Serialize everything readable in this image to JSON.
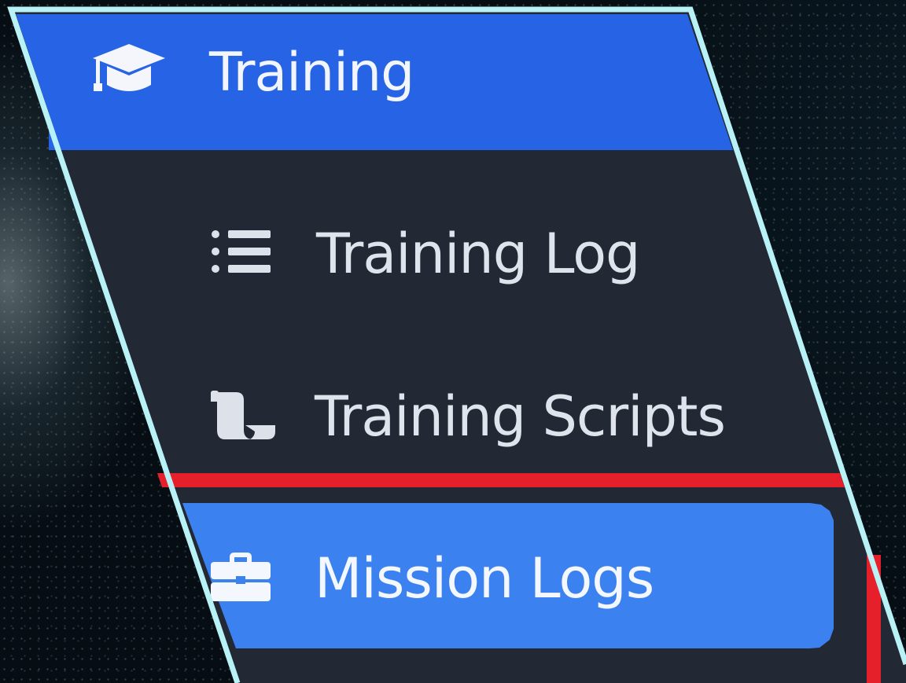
{
  "menu": {
    "header": {
      "label": "Training",
      "icon": "graduation-cap-icon"
    },
    "items": [
      {
        "label": "Training Log",
        "icon": "list-icon"
      },
      {
        "label": "Training Scripts",
        "icon": "scroll-icon"
      },
      {
        "label": "Mission Logs",
        "icon": "briefcase-icon",
        "active": true
      }
    ]
  },
  "colors": {
    "header_bg": "#2664e5",
    "panel_bg": "#222834",
    "active_bg": "#3b82f0",
    "outline": "#b9f2f6",
    "accent_red": "#e5202a"
  }
}
